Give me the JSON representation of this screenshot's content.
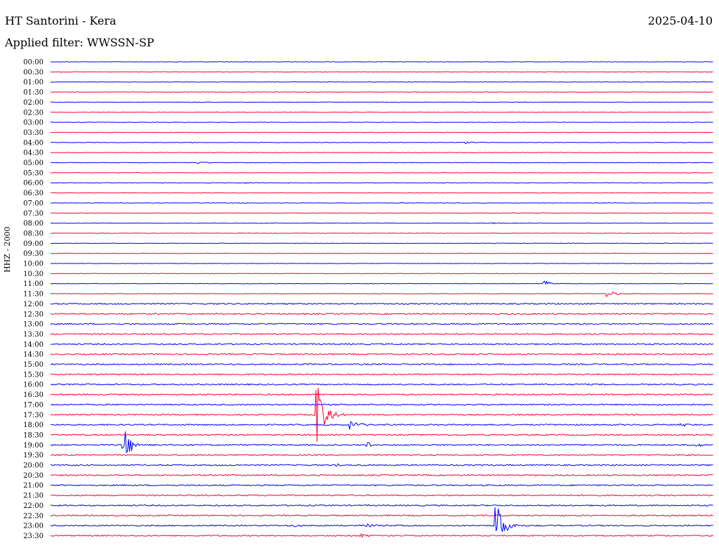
{
  "header": {
    "station": "HT Santorini - Kera",
    "date": "2025-04-10",
    "filter": "Applied filter: WWSSN-SP"
  },
  "axis": {
    "channel_label": "HHZ - 2000"
  },
  "colors": {
    "even": "#0000ff",
    "odd": "#ff0033"
  },
  "chart_data": {
    "type": "line",
    "title": "HT Santorini - Kera",
    "subtitle": "Applied filter: WWSSN-SP",
    "ylabel": "HHZ - 2000",
    "grid": false,
    "legend": "none",
    "x_range_minutes": [
      0,
      30
    ],
    "rows": [
      "00:00",
      "00:30",
      "01:00",
      "01:30",
      "02:00",
      "02:30",
      "03:00",
      "03:30",
      "04:00",
      "04:30",
      "05:00",
      "05:30",
      "06:00",
      "06:30",
      "07:00",
      "07:30",
      "08:00",
      "08:30",
      "09:00",
      "09:30",
      "10:00",
      "10:30",
      "11:00",
      "11:30",
      "12:00",
      "12:30",
      "13:00",
      "13:30",
      "14:00",
      "14:30",
      "15:00",
      "15:30",
      "16:00",
      "16:30",
      "17:00",
      "17:30",
      "18:00",
      "18:30",
      "19:00",
      "19:30",
      "20:00",
      "20:30",
      "21:00",
      "21:30",
      "22:00",
      "22:30",
      "23:00",
      "23:30"
    ],
    "row_colors": "alternating blue/red",
    "events": [
      {
        "row": "00:00",
        "minute": 8.5,
        "amp": 0.12
      },
      {
        "row": "04:00",
        "minute": 6.3,
        "amp": 0.12
      },
      {
        "row": "04:00",
        "minute": 18.7,
        "amp": 0.35
      },
      {
        "row": "05:00",
        "minute": 6.6,
        "amp": 0.45
      },
      {
        "row": "06:00",
        "minute": 8.8,
        "amp": 0.2
      },
      {
        "row": "07:00",
        "minute": 15.8,
        "amp": 0.15
      },
      {
        "row": "08:00",
        "minute": 20.0,
        "amp": 0.2
      },
      {
        "row": "11:00",
        "minute": 22.3,
        "amp": 0.8
      },
      {
        "row": "11:30",
        "minute": 25.1,
        "amp": 1.2
      },
      {
        "row": "15:00",
        "minute": 17.9,
        "amp": 0.15
      },
      {
        "row": "17:30",
        "minute": 12.0,
        "amp": 9.0
      },
      {
        "row": "18:00",
        "minute": 13.5,
        "amp": 1.5
      },
      {
        "row": "18:00",
        "minute": 28.5,
        "amp": 0.4
      },
      {
        "row": "19:00",
        "minute": 14.3,
        "amp": 0.8
      },
      {
        "row": "19:00",
        "minute": 29.2,
        "amp": 0.4
      },
      {
        "row": "19:00",
        "minute": 3.2,
        "amp": 6.0
      },
      {
        "row": "20:00",
        "minute": 12.9,
        "amp": 0.35
      },
      {
        "row": "23:00",
        "minute": 10.9,
        "amp": 0.6
      },
      {
        "row": "23:00",
        "minute": 14.3,
        "amp": 0.5
      },
      {
        "row": "23:00",
        "minute": 20.1,
        "amp": 6.5
      },
      {
        "row": "23:30",
        "minute": 14.0,
        "amp": 0.6
      }
    ]
  }
}
